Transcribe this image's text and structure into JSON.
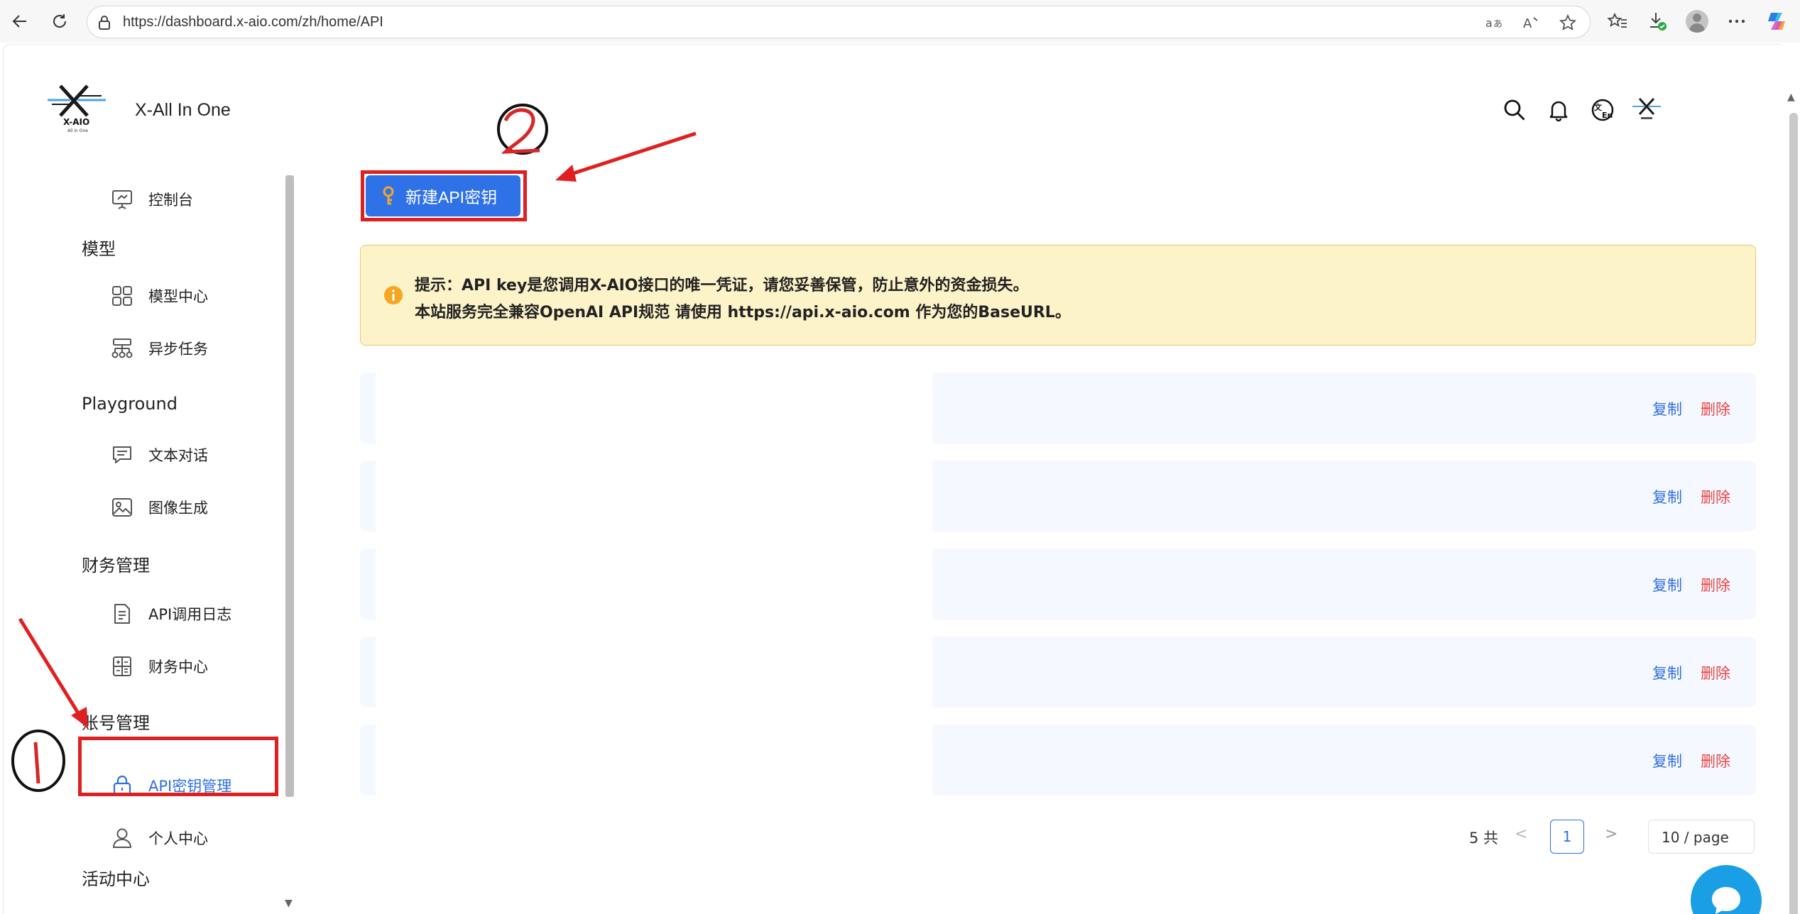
{
  "browser": {
    "url": "https://dashboard.x-aio.com/zh/home/API"
  },
  "sidebar": {
    "logo_text": "X-AIO",
    "logo_subtext": "All in One",
    "brand": "X-All In One",
    "dashboard": "控制台",
    "sections": {
      "model": "模型",
      "playground": "Playground",
      "finance": "财务管理",
      "account": "账号管理",
      "activity": "活动中心"
    },
    "items": {
      "model_center": "模型中心",
      "async_tasks": "异步任务",
      "text_chat": "文本对话",
      "image_gen": "图像生成",
      "api_logs": "API调用日志",
      "finance_center": "财务中心",
      "api_keys": "API密钥管理",
      "profile": "个人中心"
    }
  },
  "main": {
    "new_key_button": "新建API密钥",
    "notice_line1": "提示：API key是您调用X-AIO接口的唯一凭证，请您妥善保管，防止意外的资金损失。",
    "notice_line2": "本站服务完全兼容OpenAI API规范 请使用 https://api.x-aio.com 作为您的BaseURL。",
    "copy_label": "复制",
    "delete_label": "删除",
    "key_rows": [
      {
        "copy": "复制",
        "delete": "删除"
      },
      {
        "copy": "复制",
        "delete": "删除"
      },
      {
        "copy": "复制",
        "delete": "删除"
      },
      {
        "copy": "复制",
        "delete": "删除"
      },
      {
        "copy": "复制",
        "delete": "删除"
      }
    ]
  },
  "pagination": {
    "total": "5 共",
    "prev": "<",
    "page": "1",
    "next": ">",
    "page_size": "10 / page"
  },
  "colors": {
    "primary": "#2f72e8",
    "danger": "#e54545",
    "notice_bg": "#fdf3c9",
    "annotation": "#e02020"
  },
  "icons": {
    "search": "search-icon",
    "bell": "bell-icon",
    "language": "language-icon",
    "chat": "chat-icon"
  }
}
